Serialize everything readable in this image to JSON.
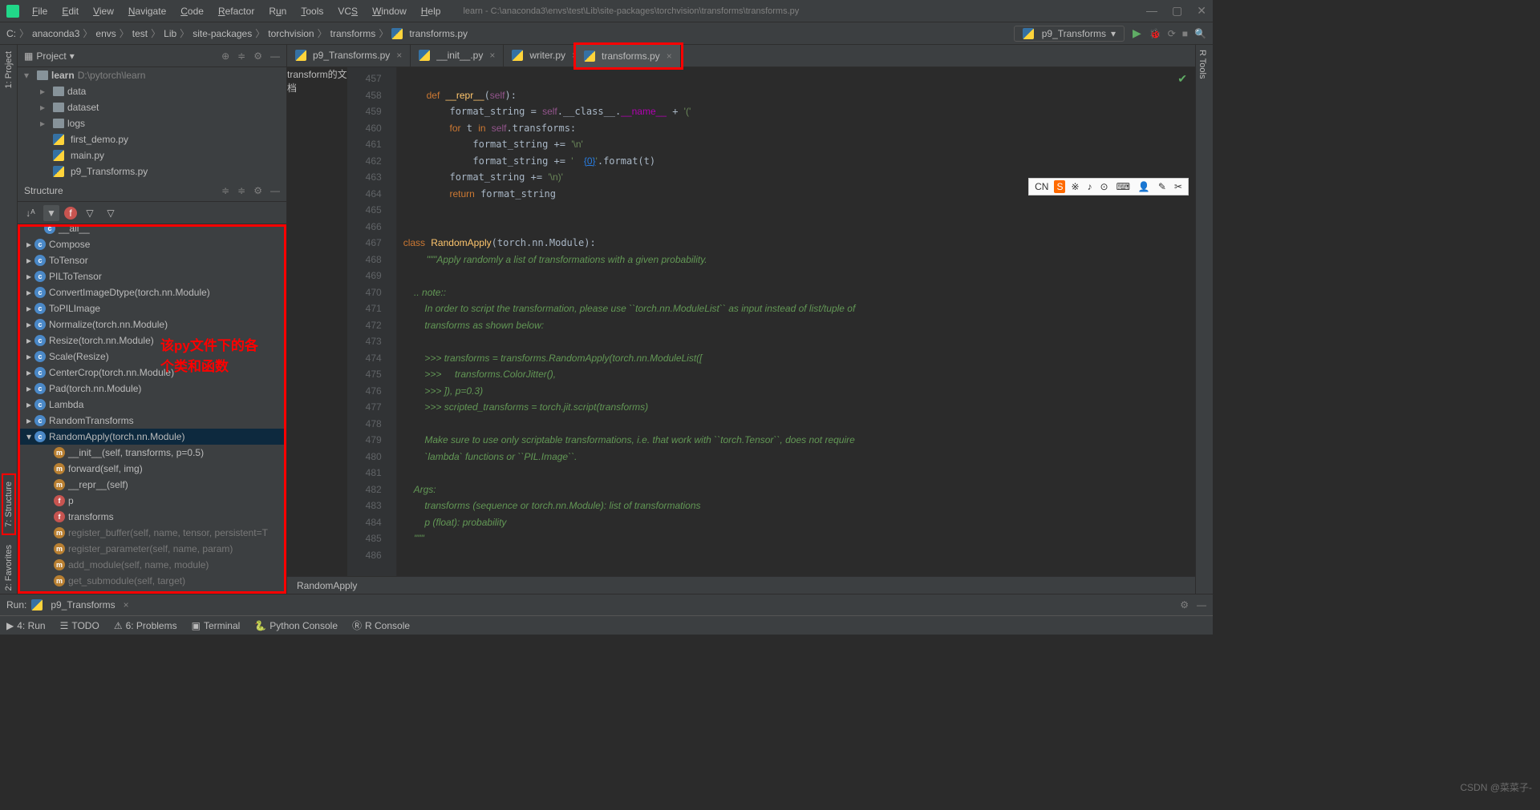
{
  "title_path": "learn - C:\\anaconda3\\envs\\test\\Lib\\site-packages\\torchvision\\transforms\\transforms.py",
  "menu": [
    "File",
    "Edit",
    "View",
    "Navigate",
    "Code",
    "Refactor",
    "Run",
    "Tools",
    "VCS",
    "Window",
    "Help"
  ],
  "breadcrumbs": [
    "C:",
    "anaconda3",
    "envs",
    "test",
    "Lib",
    "site-packages",
    "torchvision",
    "transforms",
    "transforms.py"
  ],
  "run_config": "p9_Transforms",
  "project": {
    "title": "Project",
    "root": "learn",
    "root_path": "D:\\pytorch\\learn",
    "folders": [
      "data",
      "dataset",
      "logs"
    ],
    "files": [
      "first_demo.py",
      "main.py",
      "p9_Transforms.py"
    ]
  },
  "structure": {
    "title": "Structure",
    "items": [
      {
        "t": "c",
        "n": "__all__",
        "cut": true
      },
      {
        "t": "c",
        "n": "Compose"
      },
      {
        "t": "c",
        "n": "ToTensor"
      },
      {
        "t": "c",
        "n": "PILToTensor"
      },
      {
        "t": "c",
        "n": "ConvertImageDtype(torch.nn.Module)"
      },
      {
        "t": "c",
        "n": "ToPILImage"
      },
      {
        "t": "c",
        "n": "Normalize(torch.nn.Module)"
      },
      {
        "t": "c",
        "n": "Resize(torch.nn.Module)"
      },
      {
        "t": "c",
        "n": "Scale(Resize)"
      },
      {
        "t": "c",
        "n": "CenterCrop(torch.nn.Module)"
      },
      {
        "t": "c",
        "n": "Pad(torch.nn.Module)"
      },
      {
        "t": "c",
        "n": "Lambda"
      },
      {
        "t": "c",
        "n": "RandomTransforms"
      },
      {
        "t": "c",
        "n": "RandomApply(torch.nn.Module)",
        "sel": true,
        "exp": true
      }
    ],
    "sub": [
      {
        "t": "m",
        "n": "__init__(self, transforms, p=0.5)"
      },
      {
        "t": "m",
        "n": "forward(self, img)"
      },
      {
        "t": "m",
        "n": "__repr__(self)"
      },
      {
        "t": "f",
        "n": "p"
      },
      {
        "t": "f",
        "n": "transforms"
      },
      {
        "t": "m",
        "n": "register_buffer(self, name, tensor, persistent=T",
        "dim": true
      },
      {
        "t": "m",
        "n": "register_parameter(self, name, param)",
        "dim": true
      },
      {
        "t": "m",
        "n": "add_module(self, name, module)",
        "dim": true
      },
      {
        "t": "m",
        "n": "get_submodule(self, target)",
        "dim": true
      }
    ]
  },
  "tabs": [
    {
      "n": "p9_Transforms.py"
    },
    {
      "n": "__init__.py"
    },
    {
      "n": "writer.py"
    },
    {
      "n": "transforms.py",
      "active": true,
      "red": true
    }
  ],
  "lines": [
    457,
    458,
    459,
    460,
    461,
    462,
    463,
    464,
    465,
    466,
    467,
    468,
    469,
    470,
    471,
    472,
    473,
    474,
    475,
    476,
    477,
    478,
    479,
    480,
    481,
    482,
    483,
    484,
    485,
    486
  ],
  "code_breadcrumb": "RandomApply",
  "annotation1": "transform的文\n档",
  "annotation2": "该py文件下的各\n个类和函数",
  "run_panel_title": "Run:",
  "run_panel_config": "p9_Transforms",
  "bottom": {
    "run": "4: Run",
    "todo": "TODO",
    "problems": "6: Problems",
    "terminal": "Terminal",
    "pyconsole": "Python Console",
    "rconsole": "R Console"
  },
  "ime": [
    "CN",
    "S",
    "※",
    "♪",
    "⊙",
    "⌨",
    "👤",
    "✎",
    "✂"
  ],
  "watermark": "CSDN @菜菜子-",
  "left_tabs": {
    "project": "1: Project",
    "structure": "7: Structure",
    "fav": "2: Favorites"
  },
  "right_tab": "R Tools"
}
